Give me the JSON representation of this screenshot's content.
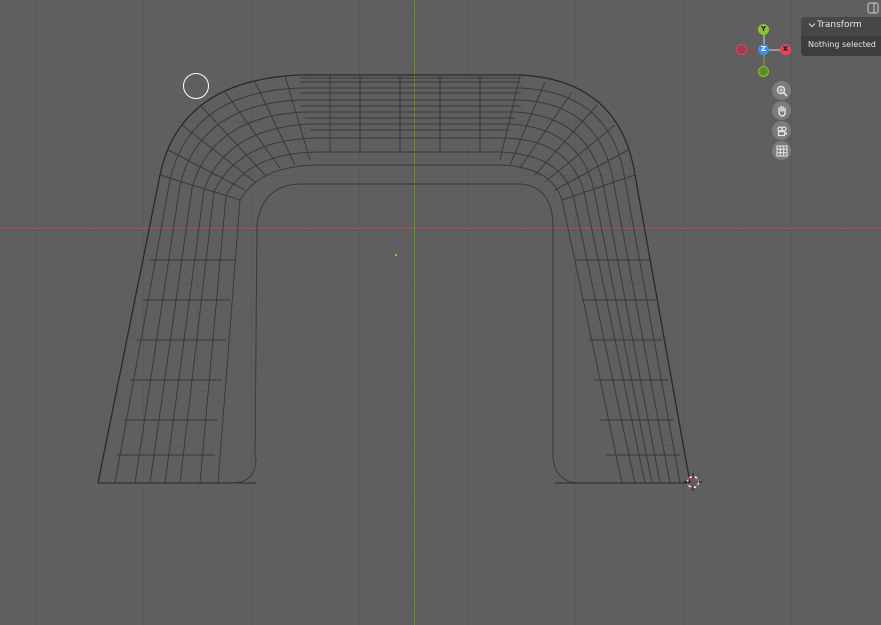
{
  "gizmo": {
    "axis_y_label": "Y",
    "axis_z_label": "Z",
    "axis_x_label": "X",
    "colors": {
      "x": "#e0475f",
      "y": "#8ac33a",
      "z": "#3f8ce8",
      "neg_x": "#9c3d4b",
      "neg_y": "#5f8a2c"
    }
  },
  "nav_buttons": [
    {
      "icon": "zoom-icon"
    },
    {
      "icon": "hand-pan-icon"
    },
    {
      "icon": "camera-icon"
    },
    {
      "icon": "grid-icon"
    }
  ],
  "panel": {
    "title": "Transform",
    "message": "Nothing selected"
  }
}
